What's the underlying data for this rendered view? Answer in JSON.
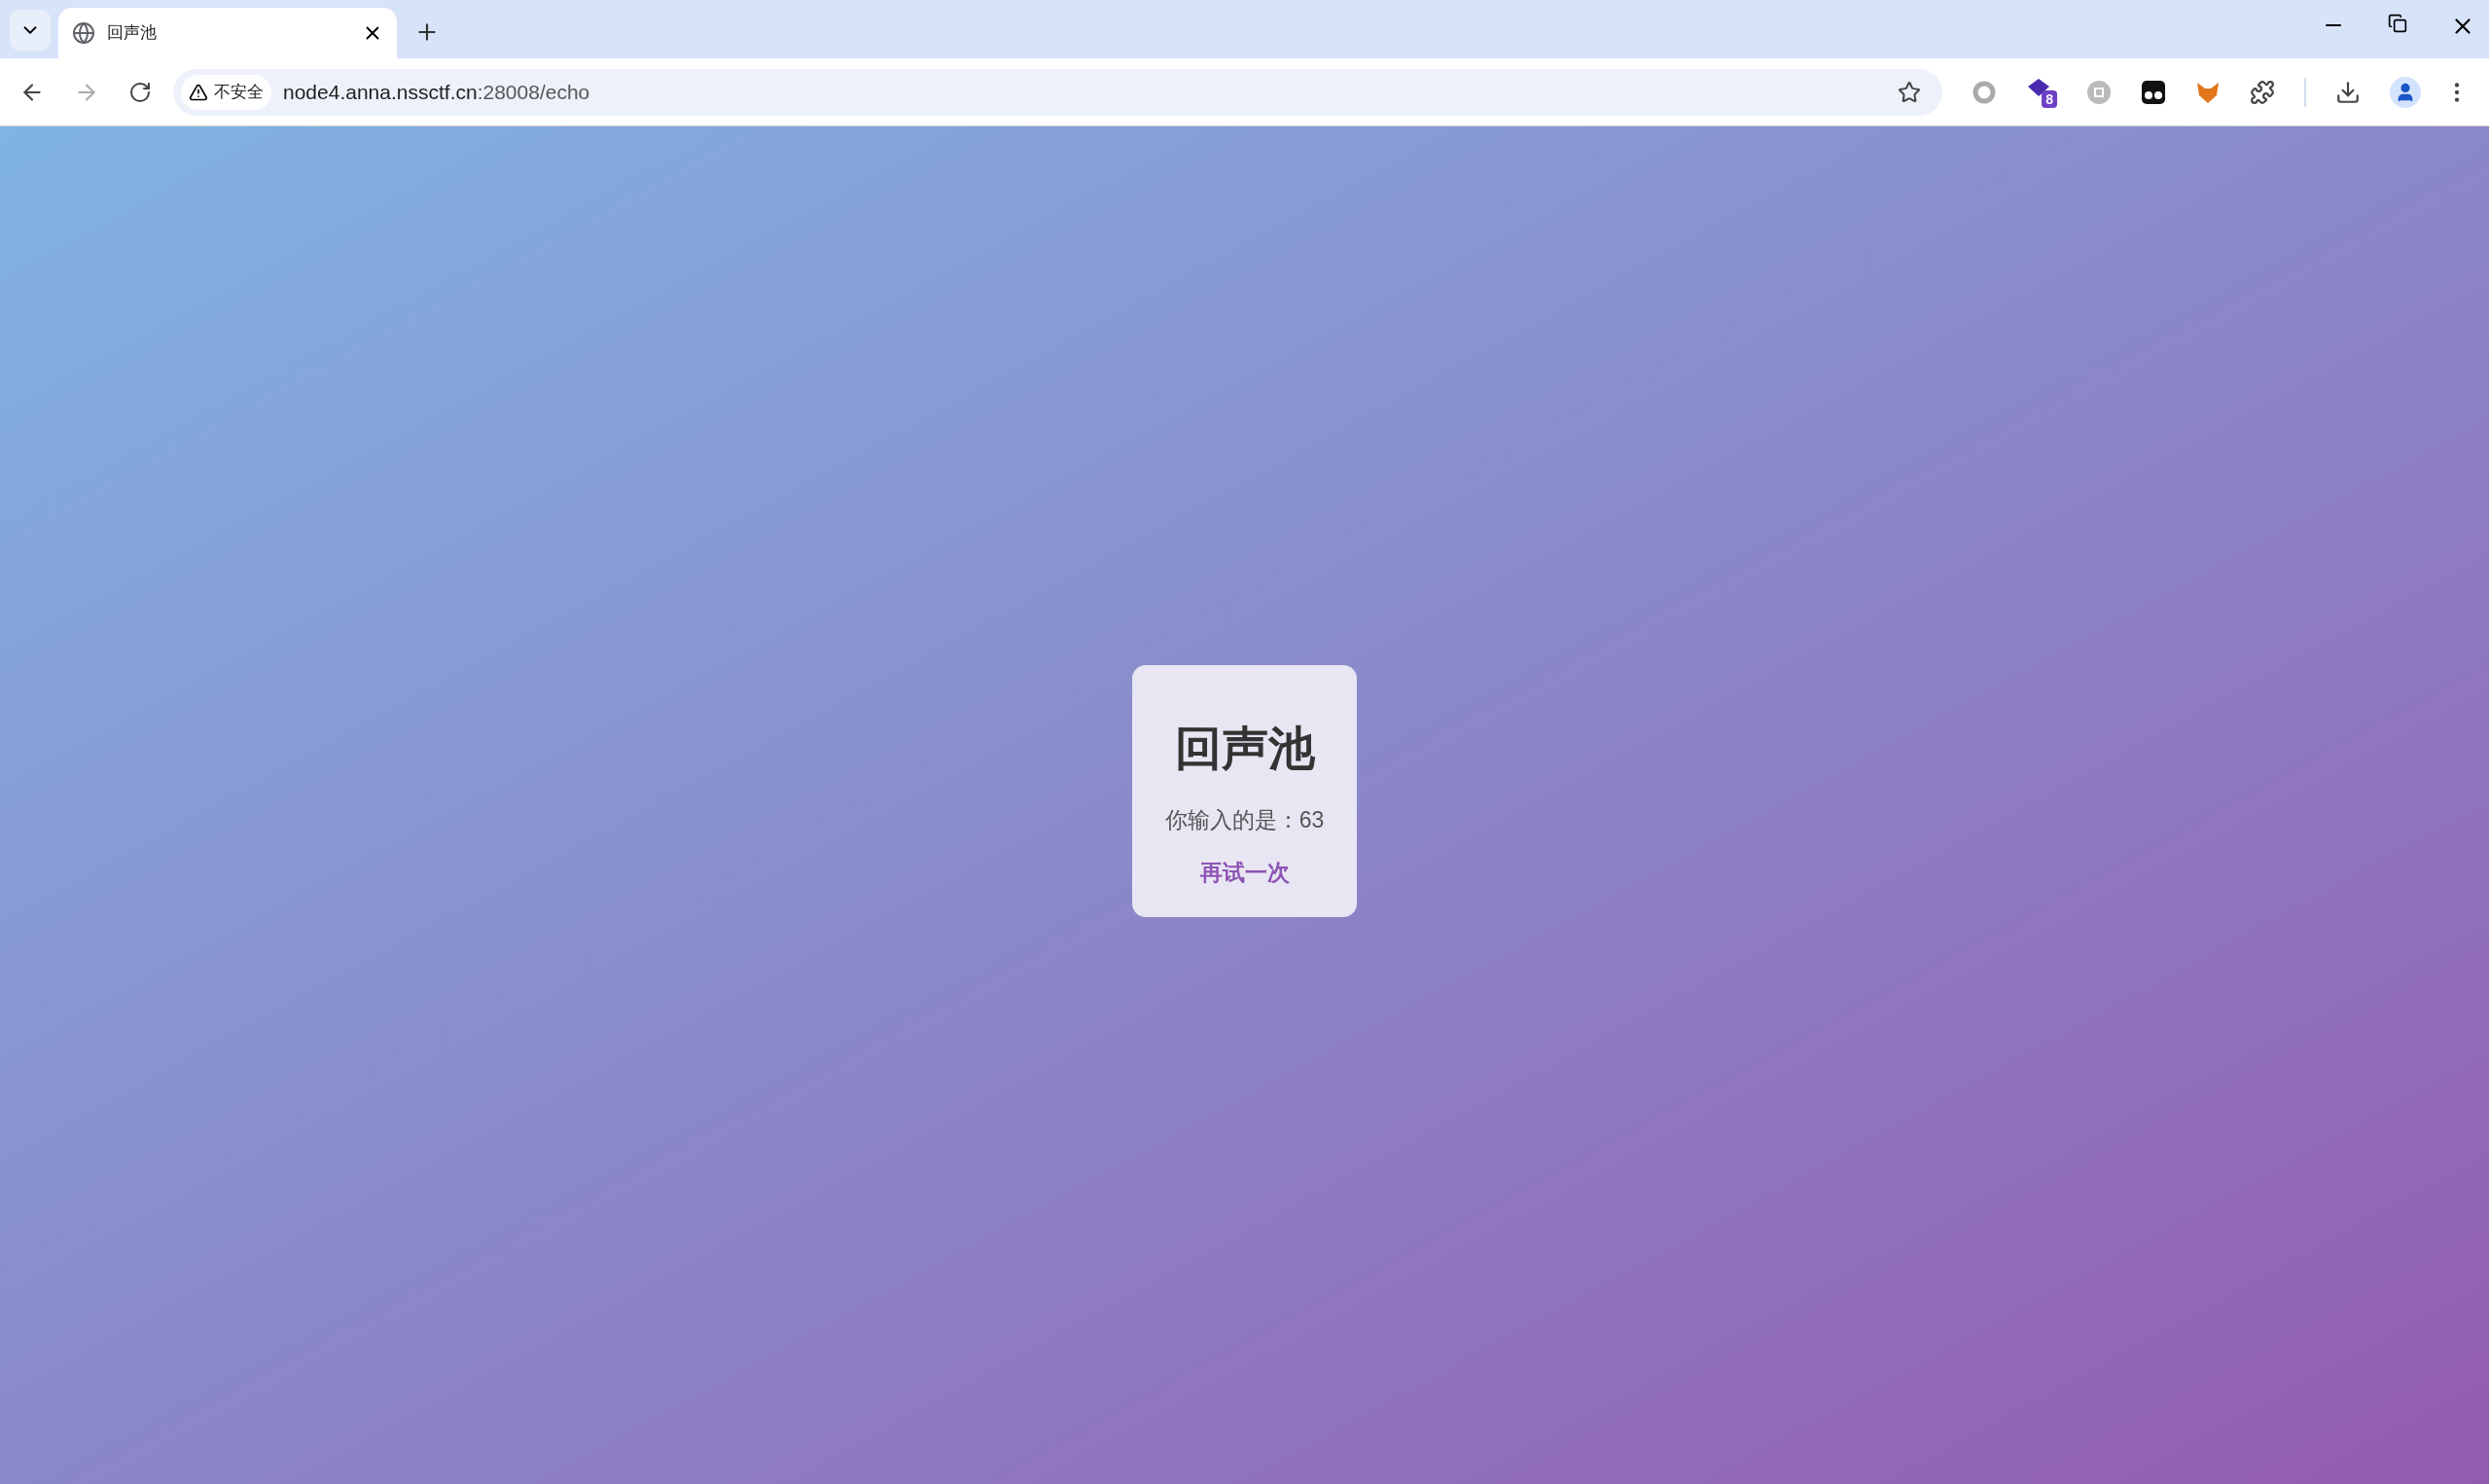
{
  "tab": {
    "title": "回声池",
    "selected": true
  },
  "address_bar": {
    "security_label": "不安全",
    "host": "node4.anna.nssctf.cn",
    "rest": ":28008/echo"
  },
  "extension_badge": "8",
  "card": {
    "title": "回声池",
    "message": "你输入的是：63",
    "link": "再试一次"
  }
}
